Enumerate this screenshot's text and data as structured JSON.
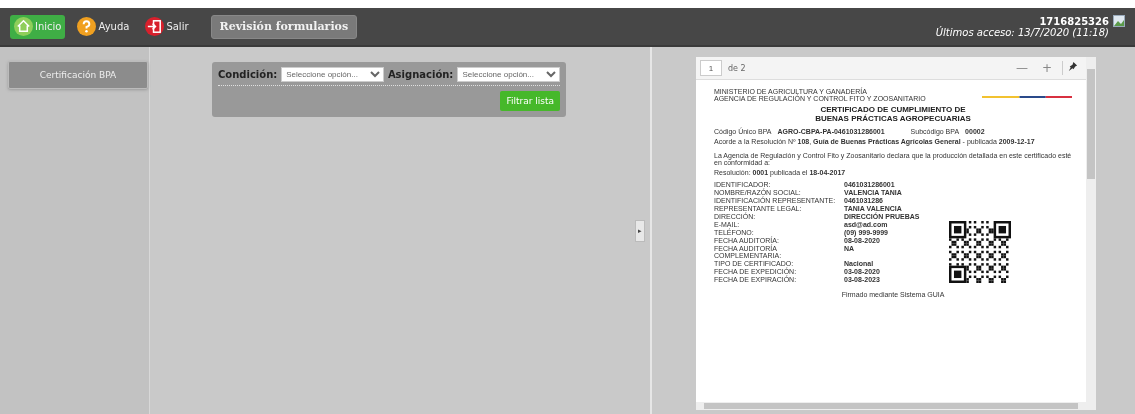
{
  "header": {
    "nav": [
      {
        "kind": "home",
        "label": "Inicio",
        "selected": true
      },
      {
        "kind": "help",
        "label": "Ayuda",
        "selected": false
      },
      {
        "kind": "exit",
        "label": "Salir",
        "selected": false
      }
    ],
    "section_button": "Revisión formularios",
    "user_id": "1716825326",
    "last_access": "Últimos acceso: 13/7/2020 (11:18)"
  },
  "sidebar": {
    "items": [
      {
        "label": "Certificación BPA",
        "selected": true
      }
    ]
  },
  "filters": {
    "condition_label": "Condición:",
    "condition_placeholder": "Seleccione opción...",
    "assignment_label": "Asignación:",
    "assignment_placeholder": "Seleccione opción...",
    "button": "Filtrar lista"
  },
  "splitter_arrow": "▸",
  "viewer": {
    "page": "1",
    "page_total": "de 2",
    "zoom_out": "—",
    "zoom_in": "+",
    "document": {
      "ministry": "MINISTERIO DE AGRICULTURA Y GANADERÍA",
      "agency": "AGENCIA DE REGULACIÓN Y CONTROL FITO Y ZOOSANITARIO",
      "title_1": "CERTIFICADO DE CUMPLIMIENTO DE",
      "title_2": "BUENAS PRÁCTICAS AGROPECUARIAS",
      "code_label": "Código Único BPA",
      "code_value": "AGRO-CBPA-PA-0461031286001",
      "subcode_label": "Subcódigo BPA",
      "subcode_value": "00002",
      "resolution_line": "Acorde a la Resolución Nº **108**, **Guía de Buenas Prácticas Agrícolas General** - publicada **2009-12-17**",
      "declaration": "La Agencia de Regulación y Control Fito y Zoosanitario declara que la producción detallada en este certificado esté en conformidad a:",
      "resolution_2": "Resolución: **0001** publicada el **18-04-2017**",
      "fields": [
        {
          "label": "IDENTIFICADOR:",
          "value": "0461031286001"
        },
        {
          "label": "NOMBRE/RAZÓN SOCIAL:",
          "value": "VALENCIA TANIA"
        },
        {
          "label": "IDENTIFICACIÓN REPRESENTANTE:",
          "value": "0461031286"
        },
        {
          "label": "REPRESENTANTE LEGAL:",
          "value": "TANIA VALENCIA"
        },
        {
          "label": "DIRECCIÓN:",
          "value": "DIRECCIÓN PRUEBAS"
        },
        {
          "label": "E-MAIL:",
          "value": "asd@ad.com"
        },
        {
          "label": "TELÉFONO:",
          "value": "(09) 999-9999"
        },
        {
          "label": "FECHA AUDITORÍA:",
          "value": "08-08-2020"
        },
        {
          "label": "FECHA AUDITORÍA COMPLEMENTARIA:",
          "value": "NA"
        },
        {
          "label": "TIPO DE CERTIFICADO:",
          "value": "Nacional"
        },
        {
          "label": "FECHA DE EXPEDICIÓN:",
          "value": "03-08-2020"
        },
        {
          "label": "FECHA DE EXPIRACIÓN:",
          "value": "03-08-2023"
        }
      ],
      "footer": "Firmado mediante Sistema GUIA"
    }
  }
}
